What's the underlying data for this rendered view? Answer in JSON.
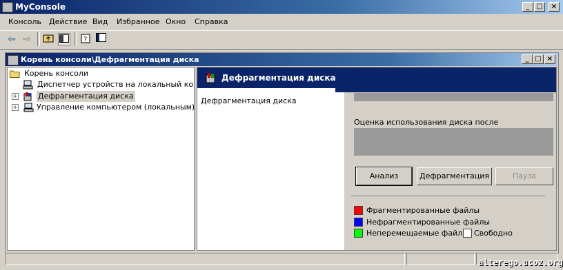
{
  "app": {
    "title": "MyConsole",
    "window_buttons": [
      "_",
      "□",
      "×"
    ]
  },
  "menu": {
    "items": [
      {
        "label": "Консоль"
      },
      {
        "label": "Действие"
      },
      {
        "label": "Вид"
      },
      {
        "label": "Избранное"
      },
      {
        "label": "Окно"
      },
      {
        "label": "Справка"
      }
    ]
  },
  "toolbar": {
    "back_icon": "arrow-left-icon",
    "forward_icon": "arrow-right-icon",
    "up_icon": "folder-up-icon",
    "show_tree_icon": "show-hide-tree-icon",
    "help_icon": "help-icon",
    "properties_icon": "properties-icon"
  },
  "child_window": {
    "title": "Корень консоли\\Дефрагментация диска",
    "buttons": [
      "_",
      "□",
      "×"
    ]
  },
  "tree": {
    "root": "Корень консоли",
    "items": [
      {
        "label": "Диспетчер устройств на локальный компью",
        "expandable": false
      },
      {
        "label": "Дефрагментация диска",
        "expandable": true,
        "selected": true
      },
      {
        "label": "Управление компьютером (локальным)",
        "expandable": true
      }
    ]
  },
  "right_pane": {
    "banner_title": "Дефрагментация диска",
    "left_description": "Дефрагментация диска",
    "estimate_label": "Оценка использования диска после дефрагментации:",
    "buttons": {
      "analyze": "Анализ",
      "defragment": "Дефрагментация",
      "pause": "Пауза"
    },
    "legend": {
      "fragmented": {
        "label": "Фрагментированные файлы",
        "color": "#ff0000"
      },
      "contiguous": {
        "label": "Нефрагментированные файлы",
        "color": "#0000ff"
      },
      "unmovable": {
        "label": "Неперемещаемые файлы",
        "color": "#00ff00"
      },
      "free": {
        "label": "Свободно",
        "color": "#ffffff"
      }
    }
  },
  "watermark": "alterego.ucoz.org",
  "colors": {
    "titlebar": "#0a246a",
    "face": "#d4d0c8"
  }
}
